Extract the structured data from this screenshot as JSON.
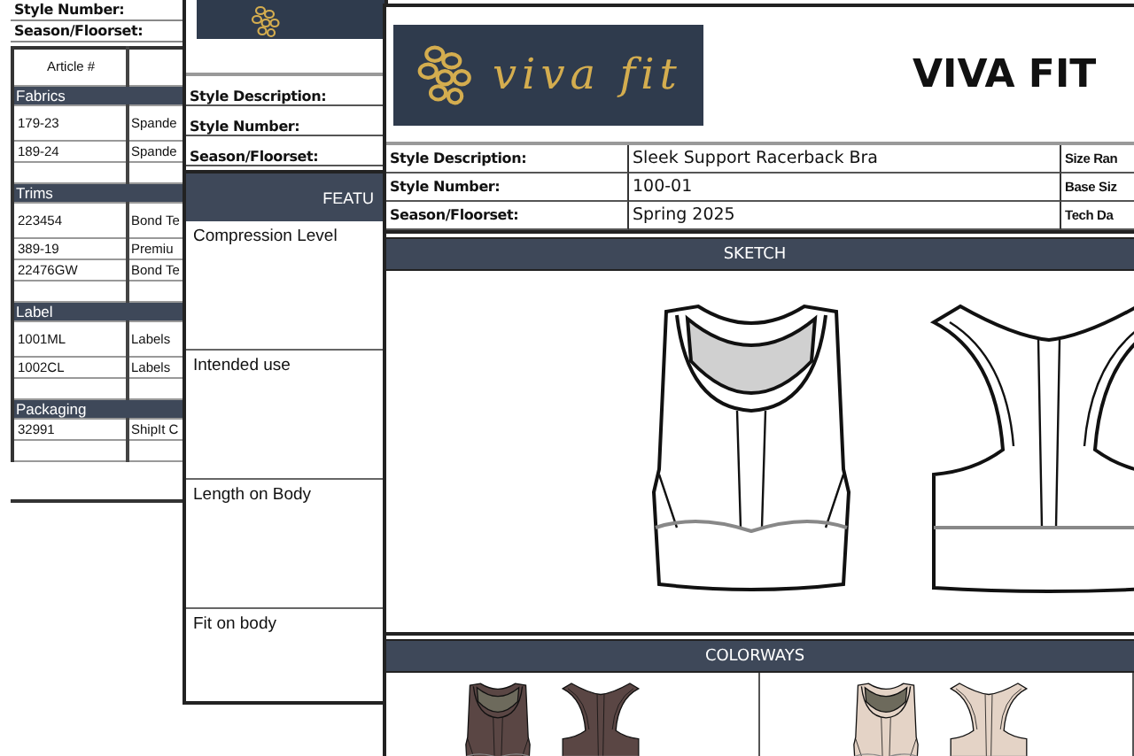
{
  "sheets": [
    {
      "kind": "materials",
      "header_labels": [
        "Style Number:",
        "Season/Floorset:"
      ],
      "columns": [
        "Article #"
      ],
      "sections": [
        {
          "title": "Fabrics",
          "rows": [
            [
              "179-23",
              "Spande"
            ],
            [
              "189-24",
              "Spande"
            ]
          ]
        },
        {
          "title": "Trims",
          "rows": [
            [
              "223454",
              "Bond Te"
            ],
            [
              "389-19",
              "Premiu"
            ],
            [
              "22476GW",
              "Bond Te"
            ]
          ]
        },
        {
          "title": "Label",
          "rows": [
            [
              "1001ML",
              "Labels"
            ],
            [
              "1002CL",
              "Labels"
            ]
          ]
        },
        {
          "title": "Packaging",
          "rows": [
            [
              "32991",
              "ShipIt C"
            ]
          ]
        }
      ]
    },
    {
      "kind": "features",
      "header_labels": [
        "Style Description:",
        "Style Number:",
        "Season/Floorset:"
      ],
      "band": "FEATU",
      "features": [
        "Compression Level",
        "Intended use",
        "Length on Body",
        "Fit on body"
      ]
    },
    {
      "kind": "spec",
      "logo_text": "viva fit",
      "title": "VIVA FIT",
      "info": [
        {
          "label": "Style Description:",
          "value": "Sleek Support Racerback Bra",
          "label_2": "Size Ran"
        },
        {
          "label": "Style Number:",
          "value": "100-01",
          "label_2": "Base Siz"
        },
        {
          "label": "Season/Floorset:",
          "value": "Spring 2025",
          "label_2": "Tech Da"
        }
      ],
      "sketch_band": "SKETCH",
      "colorways_band": "COLORWAYS",
      "colorways": [
        {
          "color": "#5a4644"
        },
        {
          "color": "#e4d3c6"
        }
      ]
    }
  ]
}
